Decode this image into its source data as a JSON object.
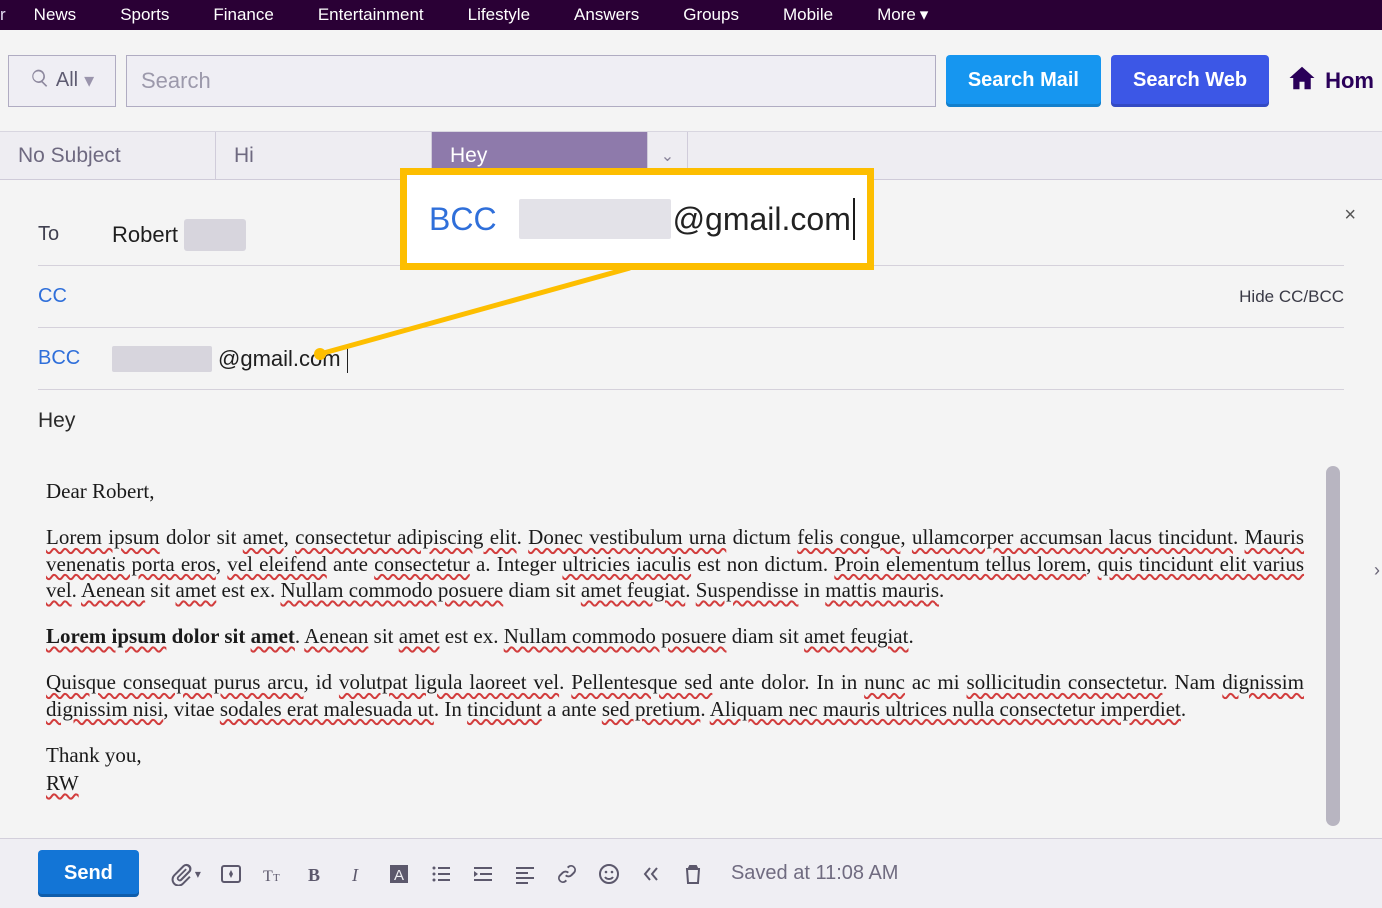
{
  "topnav": {
    "lead": "r",
    "items": [
      "News",
      "Sports",
      "Finance",
      "Entertainment",
      "Lifestyle",
      "Answers",
      "Groups",
      "Mobile"
    ],
    "more": "More"
  },
  "search": {
    "scope": "All",
    "placeholder": "Search",
    "mail_btn": "Search Mail",
    "web_btn": "Search Web",
    "home": "Hom"
  },
  "tabs": {
    "t0": "No Subject",
    "t1": "Hi",
    "t2": "Hey"
  },
  "compose": {
    "to_label": "To",
    "to_value": "Robert",
    "cc_label": "CC",
    "bcc_label": "BCC",
    "bcc_suffix": "@gmail.com",
    "hide_link": "Hide CC/BCC",
    "subject": "Hey",
    "close": "×"
  },
  "callout": {
    "label": "BCC",
    "suffix": "@gmail.com"
  },
  "body": {
    "greeting": "Dear Robert,",
    "p1a": "Lorem ipsum",
    "p1b": " dolor sit ",
    "p1c": "amet",
    "p1d": ", ",
    "p1e": "consectetur adipiscing elit",
    "p1f": ". ",
    "p1g": "Donec vestibulum urna",
    "p1h": " dictum ",
    "p1i": "felis congue",
    "p1j": ", ",
    "p1k": "ullamcorper accumsan lacus tincidunt",
    "p1l": ". ",
    "p1m": "Mauris venenatis porta eros",
    "p1n": ", ",
    "p1o": "vel eleifend",
    "p1p": " ante ",
    "p1q": "consectetur",
    "p1r": " a. Integer ",
    "p1s": "ultricies iaculis",
    "p1t": " est non dictum. ",
    "p1u": "Proin elementum tellus lorem",
    "p1v": ", ",
    "p1w": "quis tincidunt elit varius vel",
    "p1x": ". ",
    "p1y": "Aenean",
    "p1z": " sit ",
    "p1aa": "amet",
    "p1ab": " est ex. ",
    "p1ac": "Nullam commodo posuere",
    "p1ad": " diam sit ",
    "p1ae": "amet feugiat",
    "p1af": ". ",
    "p1ag": "Suspendisse",
    "p1ah": " in ",
    "p1ai": "mattis mauris",
    "p1aj": ".",
    "p2a": "Lorem ipsum",
    "p2b": " dolor sit ",
    "p2c": "amet",
    "p2d": ". ",
    "p2e": "Aenean",
    "p2f": " sit ",
    "p2g": "amet",
    "p2h": " est ex. ",
    "p2i": "Nullam commodo posuere",
    "p2j": " diam sit ",
    "p2k": "amet feugiat",
    "p2l": ".",
    "p3a": "Quisque consequat purus arcu",
    "p3b": ", id ",
    "p3c": "volutpat ligula laoreet vel",
    "p3d": ". ",
    "p3e": "Pellentesque sed",
    "p3f": " ante dolor. In in ",
    "p3g": "nunc",
    "p3h": " ac mi ",
    "p3i": "sollicitudin consectetur",
    "p3j": ". Nam ",
    "p3k": "dignissim dignissim nisi",
    "p3l": ", vitae ",
    "p3m": "sodales erat malesuada ut",
    "p3n": ". In ",
    "p3o": "tincidunt",
    "p3p": " a ante ",
    "p3q": "sed pretium",
    "p3r": ". ",
    "p3s": "Aliquam nec mauris ultrices nulla consectetur imperdiet",
    "p3t": ".",
    "thanks": "Thank you,",
    "sig": "RW"
  },
  "toolbar": {
    "send": "Send",
    "saved": "Saved at 11:08 AM"
  }
}
